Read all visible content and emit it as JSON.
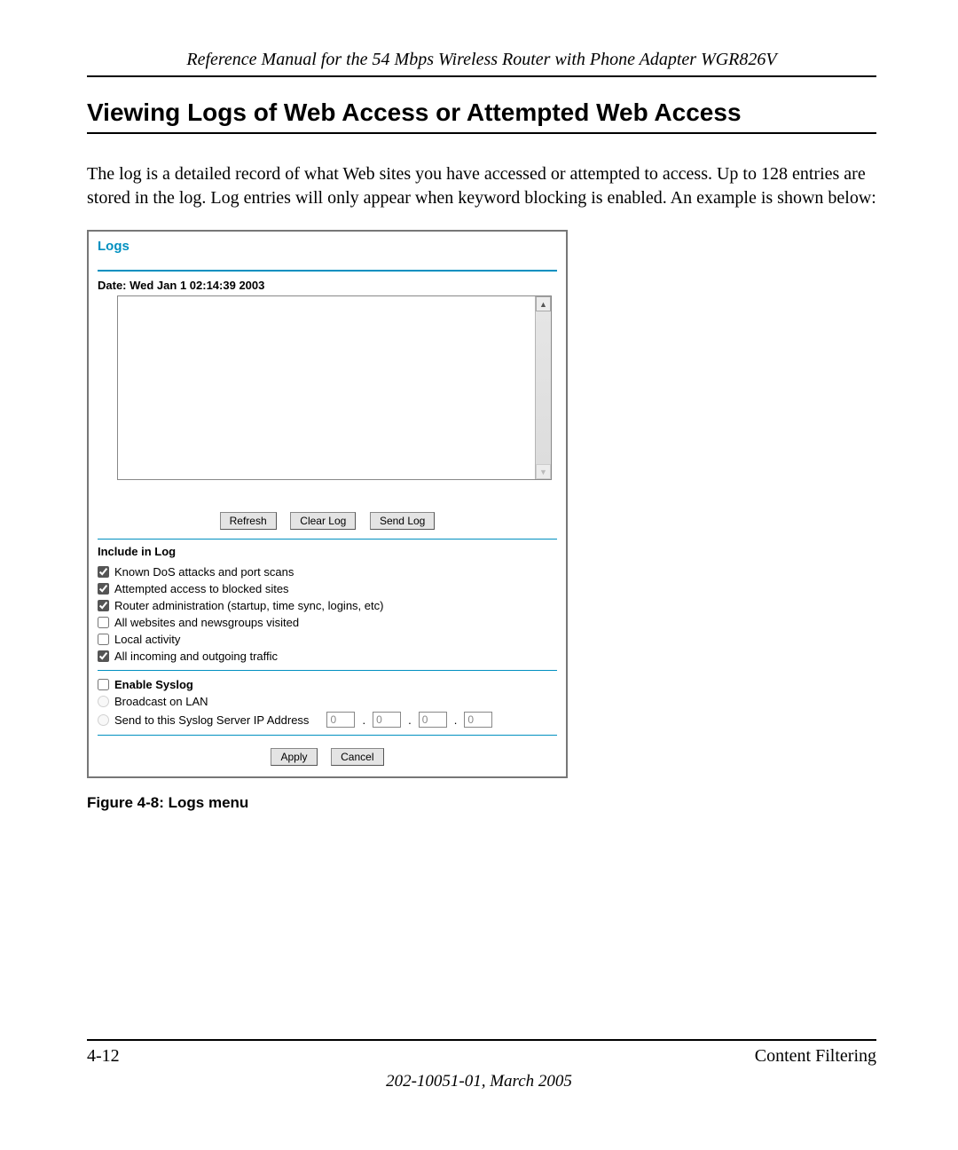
{
  "header": {
    "manual_title": "Reference Manual for the 54 Mbps Wireless Router with Phone Adapter WGR826V"
  },
  "section": {
    "title": "Viewing Logs of Web Access or Attempted Web Access",
    "body": "The log is a detailed record of what Web sites you have accessed or attempted to access. Up to 128 entries are stored in the log. Log entries will only appear when keyword blocking is enabled. An example is shown below:"
  },
  "logs_screen": {
    "title": "Logs",
    "date_label": "Date: Wed Jan 1 02:14:39 2003",
    "buttons": {
      "refresh": "Refresh",
      "clear": "Clear Log",
      "send": "Send Log"
    },
    "include_heading": "Include in Log",
    "include_options": [
      {
        "label": "Known DoS attacks and port scans",
        "checked": true
      },
      {
        "label": "Attempted access to blocked sites",
        "checked": true
      },
      {
        "label": "Router administration (startup, time sync, logins, etc)",
        "checked": true
      },
      {
        "label": "All websites and newsgroups visited",
        "checked": false
      },
      {
        "label": "Local activity",
        "checked": false
      },
      {
        "label": "All incoming and outgoing traffic",
        "checked": true
      }
    ],
    "syslog": {
      "enable_label": "Enable Syslog",
      "enable_checked": false,
      "broadcast_label": "Broadcast on LAN",
      "send_label": "Send to this Syslog Server IP Address",
      "ip": [
        "0",
        "0",
        "0",
        "0"
      ]
    },
    "footer_buttons": {
      "apply": "Apply",
      "cancel": "Cancel"
    }
  },
  "figure_caption": "Figure 4-8:  Logs menu",
  "footer": {
    "page_num": "4-12",
    "chapter": "Content Filtering",
    "docid": "202-10051-01, March 2005"
  }
}
